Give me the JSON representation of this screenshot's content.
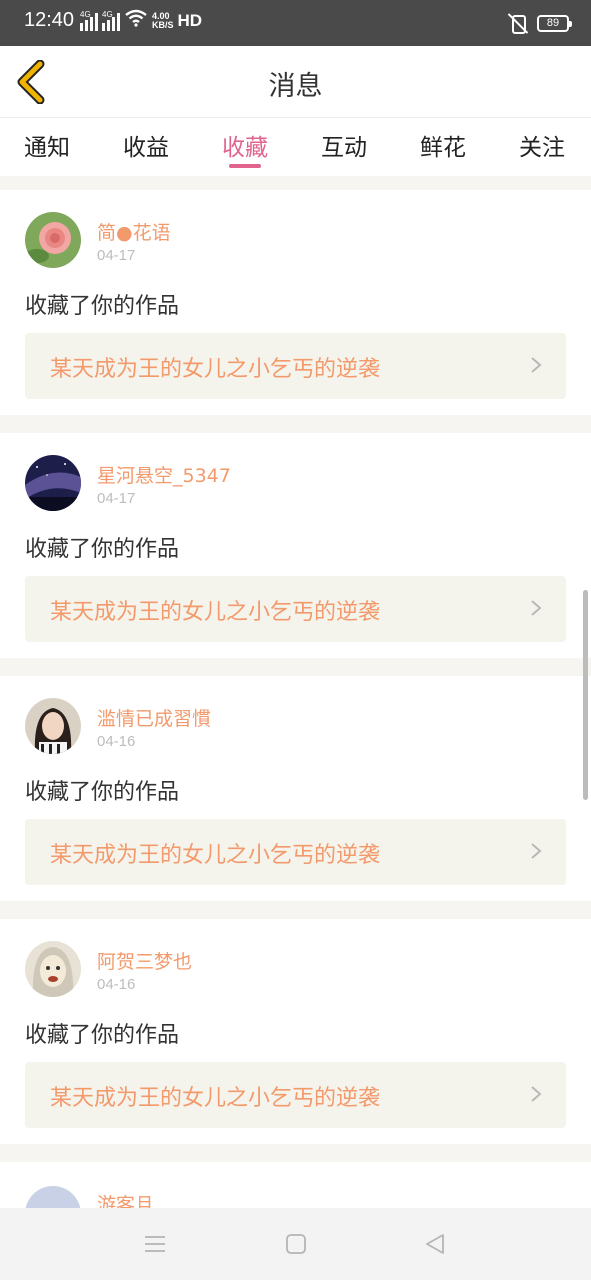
{
  "status_bar": {
    "time": "12:40",
    "net1": "4G",
    "net2": "4G",
    "speed_value": "4.00",
    "speed_unit": "KB/S",
    "hd": "HD",
    "battery": "89"
  },
  "header": {
    "title": "消息",
    "back_icon": "back-chevron-icon",
    "accent": "#f0b400"
  },
  "tabs": [
    {
      "label": "通知"
    },
    {
      "label": "收益"
    },
    {
      "label": "收藏"
    },
    {
      "label": "互动"
    },
    {
      "label": "鲜花"
    },
    {
      "label": "关注"
    }
  ],
  "active_tab": "收藏",
  "colors": {
    "active_tab": "#e0648c",
    "username": "#f39a6c",
    "work_title": "#f39a6c",
    "card_inner_bg": "#f5f4ec"
  },
  "notifications": [
    {
      "user": "简●花语",
      "date": "04-17",
      "action": "收藏了你的作品",
      "work": "某天成为王的女儿之小乞丐的逆袭"
    },
    {
      "user": "星河悬空_5347",
      "date": "04-17",
      "action": "收藏了你的作品",
      "work": "某天成为王的女儿之小乞丐的逆袭"
    },
    {
      "user": "滥情已成習慣",
      "date": "04-16",
      "action": "收藏了你的作品",
      "work": "某天成为王的女儿之小乞丐的逆袭"
    },
    {
      "user": "阿贺三梦也",
      "date": "04-16",
      "action": "收藏了你的作品",
      "work": "某天成为王的女儿之小乞丐的逆袭"
    }
  ],
  "partial_item": {
    "user": "游客且"
  },
  "nav_bar": {
    "menu_icon": "menu-icon",
    "home_icon": "home-square-icon",
    "back_icon": "back-triangle-icon"
  }
}
